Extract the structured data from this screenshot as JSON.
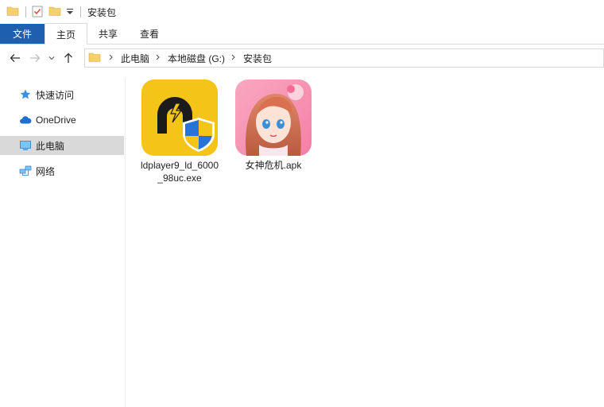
{
  "window": {
    "title": "安装包"
  },
  "ribbon": {
    "file_tab": "文件",
    "tabs": [
      "主页",
      "共享",
      "查看"
    ],
    "active_tab": 0
  },
  "address": {
    "crumbs": [
      "此电脑",
      "本地磁盘 (G:)",
      "安装包"
    ]
  },
  "sidebar": {
    "items": [
      {
        "label": "快速访问",
        "icon": "star-pin-icon"
      },
      {
        "label": "OneDrive",
        "icon": "cloud-icon"
      },
      {
        "label": "此电脑",
        "icon": "computer-icon",
        "selected": true
      },
      {
        "label": "网络",
        "icon": "network-icon"
      }
    ]
  },
  "files": [
    {
      "name": "ldplayer9_ld_6000_98uc.exe",
      "icon": "ldplayer-shield-icon"
    },
    {
      "name": "女神危机.apk",
      "icon": "anime-girl-app-icon"
    }
  ],
  "colors": {
    "file_tab_bg": "#1f5fb0",
    "ldplayer_yellow": "#f5c418",
    "selected_bg": "#d9d9d9"
  }
}
